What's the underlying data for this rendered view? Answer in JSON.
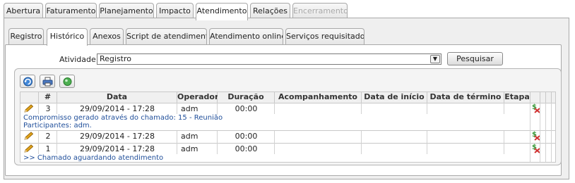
{
  "top_tabs": [
    {
      "label": "Abertura"
    },
    {
      "label": "Faturamento"
    },
    {
      "label": "Planejamento"
    },
    {
      "label": "Impacto"
    },
    {
      "label": "Atendimento"
    },
    {
      "label": "Relações"
    },
    {
      "label": "Encerramento"
    }
  ],
  "sub_tabs": [
    {
      "label": "Registro"
    },
    {
      "label": "Histórico"
    },
    {
      "label": "Anexos"
    },
    {
      "label": "Script de atendimento"
    },
    {
      "label": "Atendimento online"
    },
    {
      "label": "Serviços requisitados"
    }
  ],
  "filter": {
    "label": "Atividade :",
    "selected": "Registro",
    "search_label": "Pesquisar"
  },
  "toolbar": [
    "refresh-icon",
    "print-icon",
    "status-icon"
  ],
  "grid": {
    "columns": [
      "#",
      "Data",
      "Operador",
      "Duração",
      "Acompanhamento",
      "Data de início",
      "Data de término",
      "Etapa"
    ],
    "rows": [
      {
        "num": "3",
        "date": "29/09/2014 - 17:28",
        "operator": "adm",
        "duration": "00:00",
        "details": [
          "Compromisso gerado através do chamado: 15 - Reunião",
          "Participantes: adm."
        ]
      },
      {
        "num": "2",
        "date": "29/09/2014 - 17:28",
        "operator": "adm",
        "duration": "00:00",
        "details": []
      },
      {
        "num": "1",
        "date": "29/09/2014 - 17:28",
        "operator": "adm",
        "duration": "00:00",
        "details": [
          ">> Chamado aguardando atendimento"
        ]
      }
    ]
  },
  "colors": {
    "detail_text": "#1f4e9a",
    "pencil": "#e0a21a",
    "etapa_green": "#3a9a3a",
    "etapa_red": "#d03030"
  }
}
